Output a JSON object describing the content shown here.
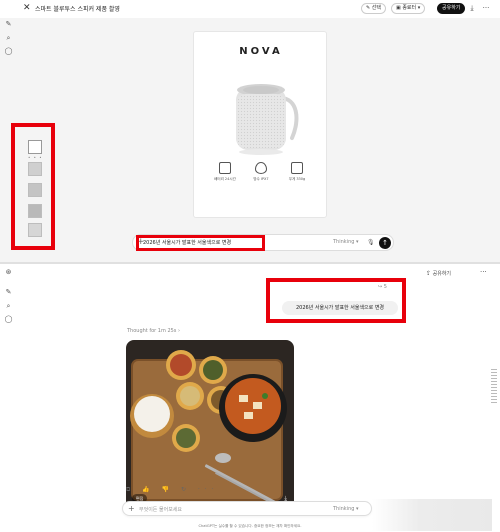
{
  "editor": {
    "close_glyph": "✕",
    "title": "스마트 블루투스 스피커 제품 촬영",
    "select_label": "선택",
    "compare_label": "종료터",
    "share_label": "공유하기",
    "download_glyph": "⤓",
    "more_glyph": "···",
    "brand": "NOVA",
    "specs": [
      {
        "icon": "battery-icon",
        "label": "배터리 24시간"
      },
      {
        "icon": "water-drop-icon",
        "label": "방수 IPX7"
      },
      {
        "icon": "weight-icon",
        "label": "무게 330g"
      }
    ],
    "thumbnail_dots": "• • •",
    "prompt_text": "2026년 서울시가 발표한 서울색으로 변경",
    "model_label": "Thinking",
    "send_glyph": "↑"
  },
  "sidebar_icons": [
    "new-chat-icon",
    "search-icon",
    "library-icon"
  ],
  "chat": {
    "share_label": "공유하기",
    "more_glyph": "···",
    "retry_glyph": "↪ 5",
    "user_message": "2026년 서울시가 발표한 서울색으로 변경",
    "thought_label": "Thought for 1m 25s  ›",
    "edit_label": "편집",
    "action_glyphs": "⧉ 👍 👎 ↻ ···",
    "input_placeholder": "무엇이든 물어보세요",
    "model_label": "Thinking",
    "disclaimer": "ChatGPT는 실수를 할 수 있습니다. 중요한 정보는 재차 확인하세요."
  },
  "colors": {
    "highlight": "#e8000b",
    "accent_dark": "#111111"
  }
}
